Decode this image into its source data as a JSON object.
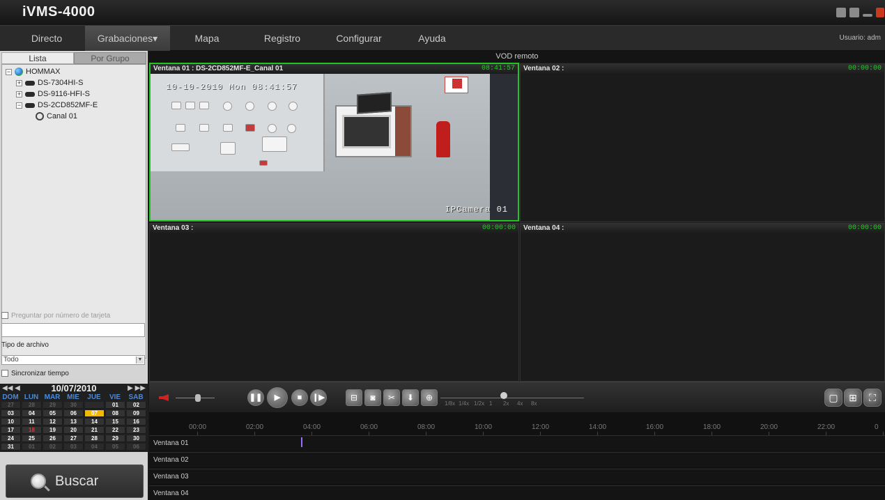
{
  "app": {
    "title": "iVMS-4000"
  },
  "menu": {
    "items": [
      {
        "label": "Directo"
      },
      {
        "label": "Grabaciones"
      },
      {
        "label": "Mapa"
      },
      {
        "label": "Registro"
      },
      {
        "label": "Configurar"
      },
      {
        "label": "Ayuda"
      }
    ],
    "active_arrow": "▾",
    "user": "Usuario: adm"
  },
  "sidebar": {
    "tabs": [
      {
        "label": "Lista"
      },
      {
        "label": "Por Grupo"
      }
    ],
    "tree": [
      {
        "label": "HOMMAX",
        "icon": "globe-icon"
      },
      {
        "label": "DS-7304HI-S",
        "icon": "dvr-icon"
      },
      {
        "label": "DS-9116-HFI-S",
        "icon": "dvr-icon"
      },
      {
        "label": "DS-2CD852MF-E",
        "icon": "dvr-icon"
      },
      {
        "label": "Canal 01",
        "icon": "camera-icon"
      }
    ],
    "card_search_label": "Preguntar por número de tarjeta",
    "card_input_value": "",
    "file_type_label": "Tipo de archivo",
    "file_type_value": "Todo",
    "sync_label": "Sincronizar tiempo"
  },
  "calendar": {
    "date": "10/07/2010",
    "nav_prev": "◀◀ ◀",
    "nav_next": "▶ ▶▶",
    "days_of_week": [
      "DOM",
      "LUN",
      "MAR",
      "MIE",
      "JUE",
      "VIE",
      "SAB"
    ],
    "weeks": [
      [
        "27",
        "28",
        "29",
        "30",
        "",
        "01",
        "02"
      ],
      [
        "03",
        "04",
        "05",
        "06",
        "07",
        "08",
        "09"
      ],
      [
        "10",
        "11",
        "12",
        "13",
        "14",
        "15",
        "16"
      ],
      [
        "17",
        "18",
        "19",
        "20",
        "21",
        "22",
        "23"
      ],
      [
        "24",
        "25",
        "26",
        "27",
        "28",
        "29",
        "30"
      ],
      [
        "31",
        "01",
        "02",
        "03",
        "04",
        "05",
        "06"
      ]
    ],
    "today": "07",
    "recorded_day": "18"
  },
  "search": {
    "label": "Buscar"
  },
  "view": {
    "title": "VOD remoto",
    "windows": [
      {
        "title": "Ventana 01 : DS-2CD852MF-E_Canal 01",
        "time": "08:41:57"
      },
      {
        "title": "Ventana 02 :",
        "time": "00:00:00"
      },
      {
        "title": "Ventana 03 :",
        "time": "00:00:00"
      },
      {
        "title": "Ventana 04 :",
        "time": "00:00:00"
      }
    ],
    "osd_time": "10-10-2010 Mon 08:41:57",
    "osd_name": "IPCamera 01"
  },
  "toolbar": {
    "speeds": [
      "1/8x",
      "1/4x",
      "1/2x",
      "1",
      "2x",
      "4x",
      "8x"
    ]
  },
  "timeline": {
    "hours": [
      "00:00",
      "02:00",
      "04:00",
      "06:00",
      "08:00",
      "10:00",
      "12:00",
      "14:00",
      "16:00",
      "18:00",
      "20:00",
      "22:00",
      "0"
    ],
    "rows": [
      {
        "label": "Ventana 01"
      },
      {
        "label": "Ventana 02"
      },
      {
        "label": "Ventana 03"
      },
      {
        "label": "Ventana 04"
      }
    ]
  }
}
